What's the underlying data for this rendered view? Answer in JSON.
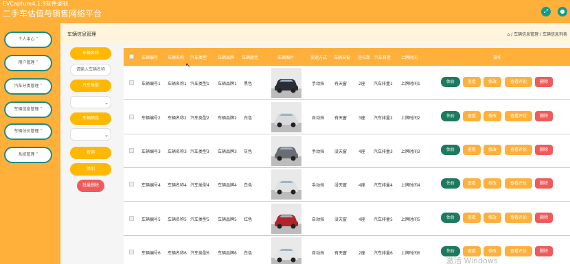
{
  "window": {
    "capture_label": "EVCapture4.1.9软件录制",
    "app_title": "二手车估值与销售网络平台"
  },
  "header_icons": [
    "expand-icon",
    "user-icon"
  ],
  "sidebar": {
    "items": [
      {
        "label": "个人中心"
      },
      {
        "label": "用户管理"
      },
      {
        "label": "汽车分类管理"
      },
      {
        "label": "车辆信息管理"
      },
      {
        "label": "车辆估价管理"
      },
      {
        "label": "系统管理"
      }
    ]
  },
  "page": {
    "title": "车辆信息管理",
    "breadcrumb": "⌂ / 车辆信息管理 / 车辆信息列表"
  },
  "filter": {
    "name_label": "车辆名称",
    "name_placeholder": "请输入车辆名称",
    "type_label": "汽车类型",
    "color_label": "车辆颜色",
    "search_label": "查询",
    "add_label": "添加",
    "batch_delete_label": "批量删除"
  },
  "table": {
    "headers": [
      "车辆编号",
      "车辆名称",
      "汽车类型",
      "车辆品牌",
      "车辆颜色",
      "车辆图片",
      "变速方式",
      "车辆天窗",
      "座位数",
      "汽车排量",
      "上牌时间",
      "操作"
    ],
    "actions": {
      "evaluate": "估价",
      "view": "查看",
      "edit": "修改",
      "comments": "查看评论",
      "delete": "删除"
    },
    "rows": [
      {
        "id": "车辆编号1",
        "name": "车辆名称1",
        "type": "汽车类型1",
        "brand": "车辆品牌1",
        "color": "黑色",
        "car_color": "#2a2d38",
        "transmission": "手动挡",
        "sunroof": "有天窗",
        "seats": "2座",
        "displacement": "汽车排量1",
        "reg": "上牌时间1"
      },
      {
        "id": "车辆编号2",
        "name": "车辆名称2",
        "type": "汽车类型2",
        "brand": "车辆品牌2",
        "color": "白色",
        "car_color": "#d8dadd",
        "transmission": "自动挡",
        "sunroof": "有天窗",
        "seats": "3座",
        "displacement": "汽车排量2",
        "reg": "上牌时间2"
      },
      {
        "id": "车辆编号3",
        "name": "车辆名称3",
        "type": "汽车类型3",
        "brand": "车辆品牌3",
        "color": "灰色",
        "car_color": "#6a6d72",
        "transmission": "手动挡",
        "sunroof": "没天窗",
        "seats": "4座",
        "displacement": "汽车排量3",
        "reg": "上牌时间3"
      },
      {
        "id": "车辆编号4",
        "name": "车辆名称4",
        "type": "汽车类型4",
        "brand": "车辆品牌4",
        "color": "白色",
        "car_color": "#dfe1e3",
        "transmission": "手动挡",
        "sunroof": "没天窗",
        "seats": "4座",
        "displacement": "汽车排量4",
        "reg": "上牌时间4"
      },
      {
        "id": "车辆编号5",
        "name": "车辆名称5",
        "type": "汽车类型5",
        "brand": "车辆品牌5",
        "color": "红色",
        "car_color": "#b3242a",
        "transmission": "自动挡",
        "sunroof": "没天窗",
        "seats": "4座",
        "displacement": "汽车排量5",
        "reg": "上牌时间5"
      },
      {
        "id": "车辆编号6",
        "name": "车辆名称6",
        "type": "汽车类型6",
        "brand": "车辆品牌6",
        "color": "白色",
        "car_color": "#e4e5e6",
        "transmission": "自动挡",
        "sunroof": "有天窗",
        "seats": "2座",
        "displacement": "汽车排量6",
        "reg": "上牌时间6"
      }
    ]
  },
  "watermark": "激活 Windows",
  "colors": {
    "accent": "#ffb03a",
    "teal": "#1a8c82",
    "danger": "#f05a5a",
    "evaluate": "#1c7a5e"
  }
}
